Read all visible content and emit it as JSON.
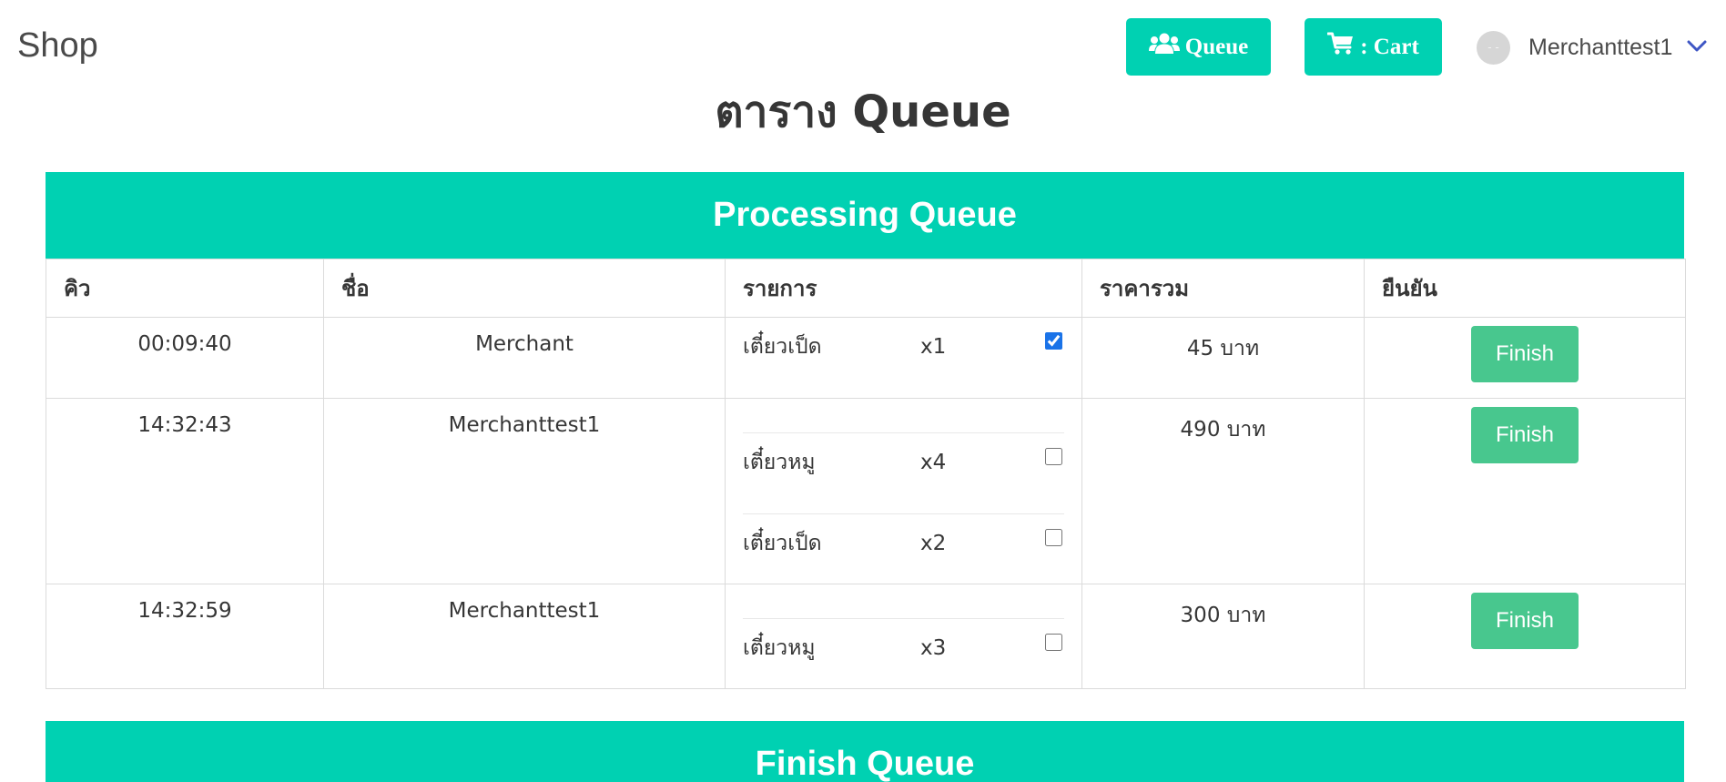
{
  "navbar": {
    "brand": "Shop",
    "queue_label": "Queue",
    "cart_label": ": Cart",
    "user_name": "Merchanttest1",
    "avatar_text": "- -"
  },
  "page_title": "ตาราง Queue",
  "colors": {
    "primary": "#00d1b2",
    "success": "#48c78e",
    "dropdown_chevron": "#3e56c4"
  },
  "icons": {
    "queue": "users-icon",
    "cart": "shopping-cart-icon",
    "user_menu": "chevron-down-icon"
  },
  "processing": {
    "title": "Processing Queue",
    "headers": [
      "คิว",
      "ชื่อ",
      "รายการ",
      "ราคารวม",
      "ยืนยัน"
    ],
    "rows": [
      {
        "time": "00:09:40",
        "name": "Merchant",
        "items": [
          {
            "name": "เตี๋ยวเป็ด",
            "qty": "x1",
            "checked": true
          }
        ],
        "total": "45 บาท",
        "action": "Finish"
      },
      {
        "time": "14:32:43",
        "name": "Merchanttest1",
        "items": [
          {
            "name": "เตี๋ยวหมู",
            "qty": "x4",
            "checked": false
          },
          {
            "name": "เตี๋ยวเป็ด",
            "qty": "x2",
            "checked": false
          }
        ],
        "total": "490 บาท",
        "action": "Finish"
      },
      {
        "time": "14:32:59",
        "name": "Merchanttest1",
        "items": [
          {
            "name": "เตี๋ยวหมู",
            "qty": "x3",
            "checked": false
          }
        ],
        "total": "300 บาท",
        "action": "Finish"
      }
    ]
  },
  "finish": {
    "title": "Finish Queue"
  }
}
